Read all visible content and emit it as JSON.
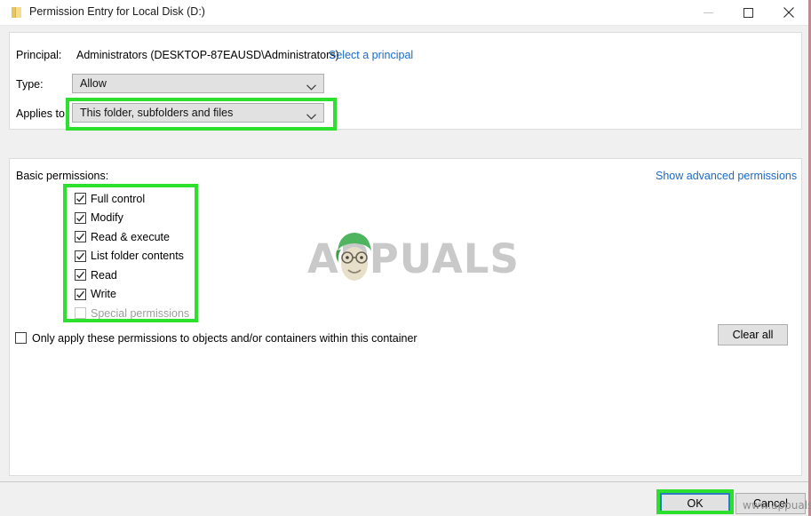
{
  "window": {
    "title": "Permission Entry for Local Disk (D:)",
    "icon": "folder-icon",
    "minimize_label": "Minimize",
    "maximize_label": "Maximize",
    "close_label": "Close"
  },
  "form": {
    "principal_label": "Principal:",
    "principal_value": "Administrators (DESKTOP-87EAUSD\\Administrators)",
    "select_principal_link": "Select a principal",
    "type_label": "Type:",
    "type_value": "Allow",
    "applies_to_label": "Applies to:",
    "applies_to_value": "This folder, subfolders and files"
  },
  "permissions": {
    "section_label": "Basic permissions:",
    "advanced_link": "Show advanced permissions",
    "items": [
      {
        "label": "Full control",
        "checked": true,
        "enabled": true
      },
      {
        "label": "Modify",
        "checked": true,
        "enabled": true
      },
      {
        "label": "Read & execute",
        "checked": true,
        "enabled": true
      },
      {
        "label": "List folder contents",
        "checked": true,
        "enabled": true
      },
      {
        "label": "Read",
        "checked": true,
        "enabled": true
      },
      {
        "label": "Write",
        "checked": true,
        "enabled": true
      },
      {
        "label": "Special permissions",
        "checked": false,
        "enabled": false
      }
    ],
    "only_apply_label": "Only apply these permissions to objects and/or containers within this container",
    "only_apply_checked": false,
    "clear_all_label": "Clear all"
  },
  "footer": {
    "ok_label": "OK",
    "cancel_label": "Cancel"
  },
  "watermark": {
    "brand": "APPUALS",
    "url": "www.appuals.com"
  },
  "colors": {
    "highlight_green": "#2ee02e",
    "link_blue": "#1b6ac9",
    "focus_blue": "#2b7ac4",
    "frame_red": "#c08a92"
  }
}
